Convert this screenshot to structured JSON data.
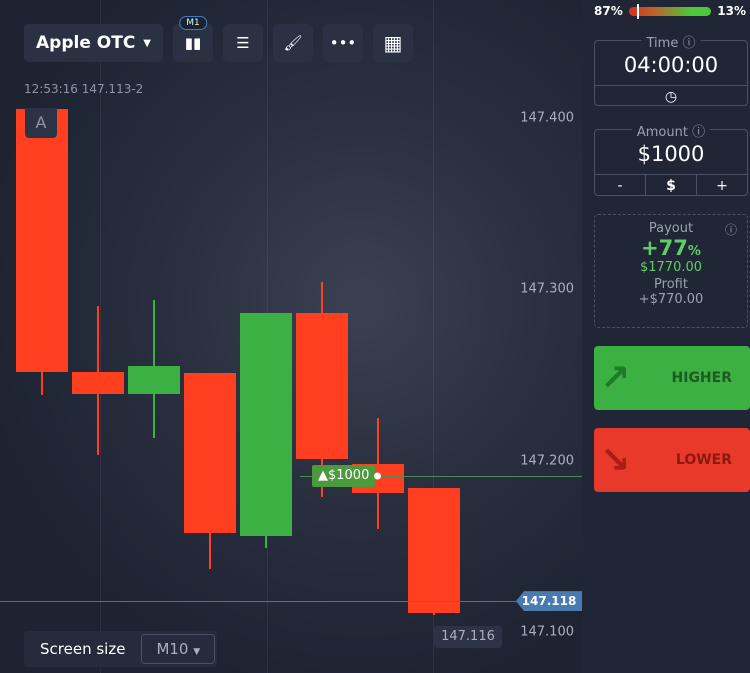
{
  "asset": "Apple OTC",
  "timeframe_badge": "M1",
  "crosshair_label": "12:53:16 147.113-2",
  "chart_marker": "A",
  "sentiment": {
    "sell_pct": "87%",
    "buy_pct": "13%",
    "sell_fraction": 0.87
  },
  "time": {
    "label": "Time",
    "value": "04:00:00"
  },
  "amount": {
    "label": "Amount",
    "value": "$1000",
    "minus": "-",
    "currency": "$",
    "plus": "+"
  },
  "payout": {
    "label": "Payout",
    "percent": "+77",
    "percent_sign": "%",
    "total": "$1770.00",
    "profit_label": "Profit",
    "profit": "+$770.00"
  },
  "buttons": {
    "higher": "HIGHER",
    "lower": "LOWER"
  },
  "trade_marker": "▲$1000",
  "screen_size": {
    "label": "Screen size",
    "value": "M10"
  },
  "colors": {
    "up": "#3cb043",
    "down": "#ff3f1f",
    "accent": "#4a7bb0"
  },
  "chart_data": {
    "type": "candlestick",
    "y_ticks": [
      "147.400",
      "147.300",
      "147.200",
      "147.100"
    ],
    "ylim": [
      147.095,
      147.47
    ],
    "candles": [
      {
        "o": 147.405,
        "h": 147.405,
        "l": 147.238,
        "c": 147.252
      },
      {
        "o": 147.252,
        "h": 147.29,
        "l": 147.203,
        "c": 147.239
      },
      {
        "o": 147.239,
        "h": 147.294,
        "l": 147.213,
        "c": 147.255
      },
      {
        "o": 147.251,
        "h": 147.251,
        "l": 147.137,
        "c": 147.158
      },
      {
        "o": 147.156,
        "h": 147.286,
        "l": 147.149,
        "c": 147.286
      },
      {
        "o": 147.286,
        "h": 147.304,
        "l": 147.179,
        "c": 147.201
      },
      {
        "o": 147.198,
        "h": 147.225,
        "l": 147.16,
        "c": 147.181
      },
      {
        "o": 147.184,
        "h": 147.184,
        "l": 147.11,
        "c": 147.111
      }
    ],
    "trade_price": 147.191,
    "current_price": "147.118",
    "hover_price": "147.116"
  }
}
